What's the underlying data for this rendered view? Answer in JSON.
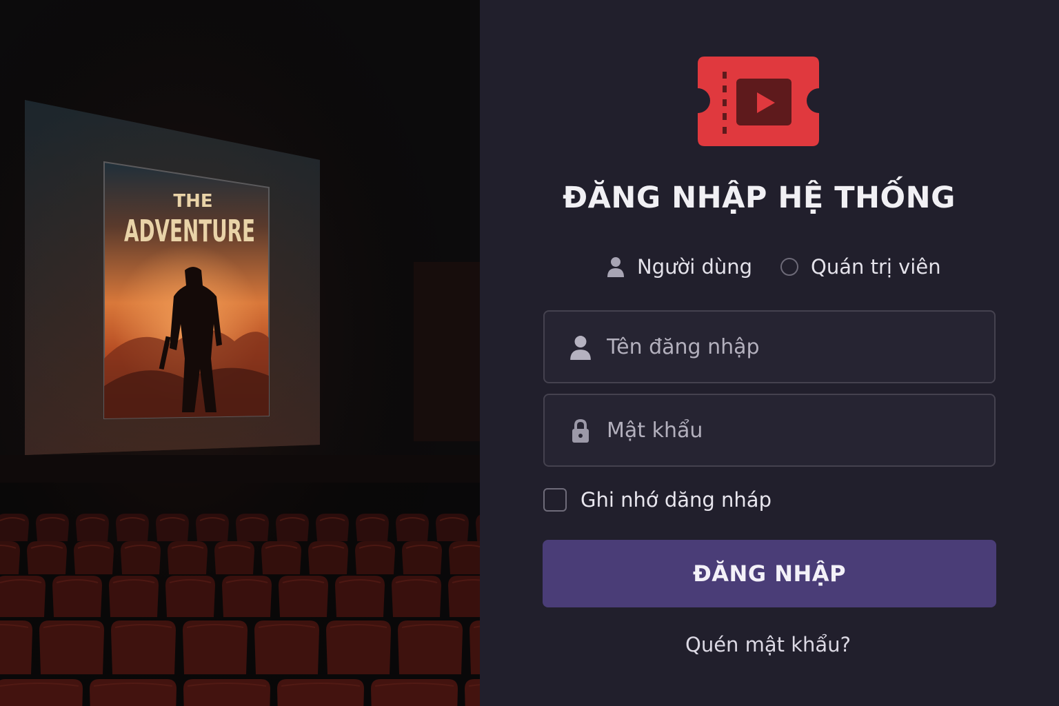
{
  "colors": {
    "panel_background": "#211f2c",
    "field_background": "#262432",
    "field_border": "#45424f",
    "primary_button": "#4a3d77",
    "logo_red": "#e0393e",
    "logo_dark": "#5e1a1c",
    "text_primary": "#f1f0f4",
    "text_muted": "#b3b0bd"
  },
  "poster": {
    "line1": "THE",
    "line2": "ADVENTURE"
  },
  "login": {
    "title": "ĐĂNG NHẬP HỆ THỐNG",
    "roles": {
      "user_label": "Người dùng",
      "user_icon": "person-icon",
      "admin_label": "Quán trị viên",
      "admin_icon": "radio-circle"
    },
    "username": {
      "placeholder": "Tên đăng nhập",
      "value": "",
      "icon": "person-icon"
    },
    "password": {
      "placeholder": "Mật khẩu",
      "value": "",
      "icon": "lock-icon"
    },
    "remember_label": "Ghi nhớ dăng nháp",
    "remember_checked": false,
    "submit_label": "ĐĂNG NHẬP",
    "forgot_label": "Quén mật khẩu?"
  }
}
